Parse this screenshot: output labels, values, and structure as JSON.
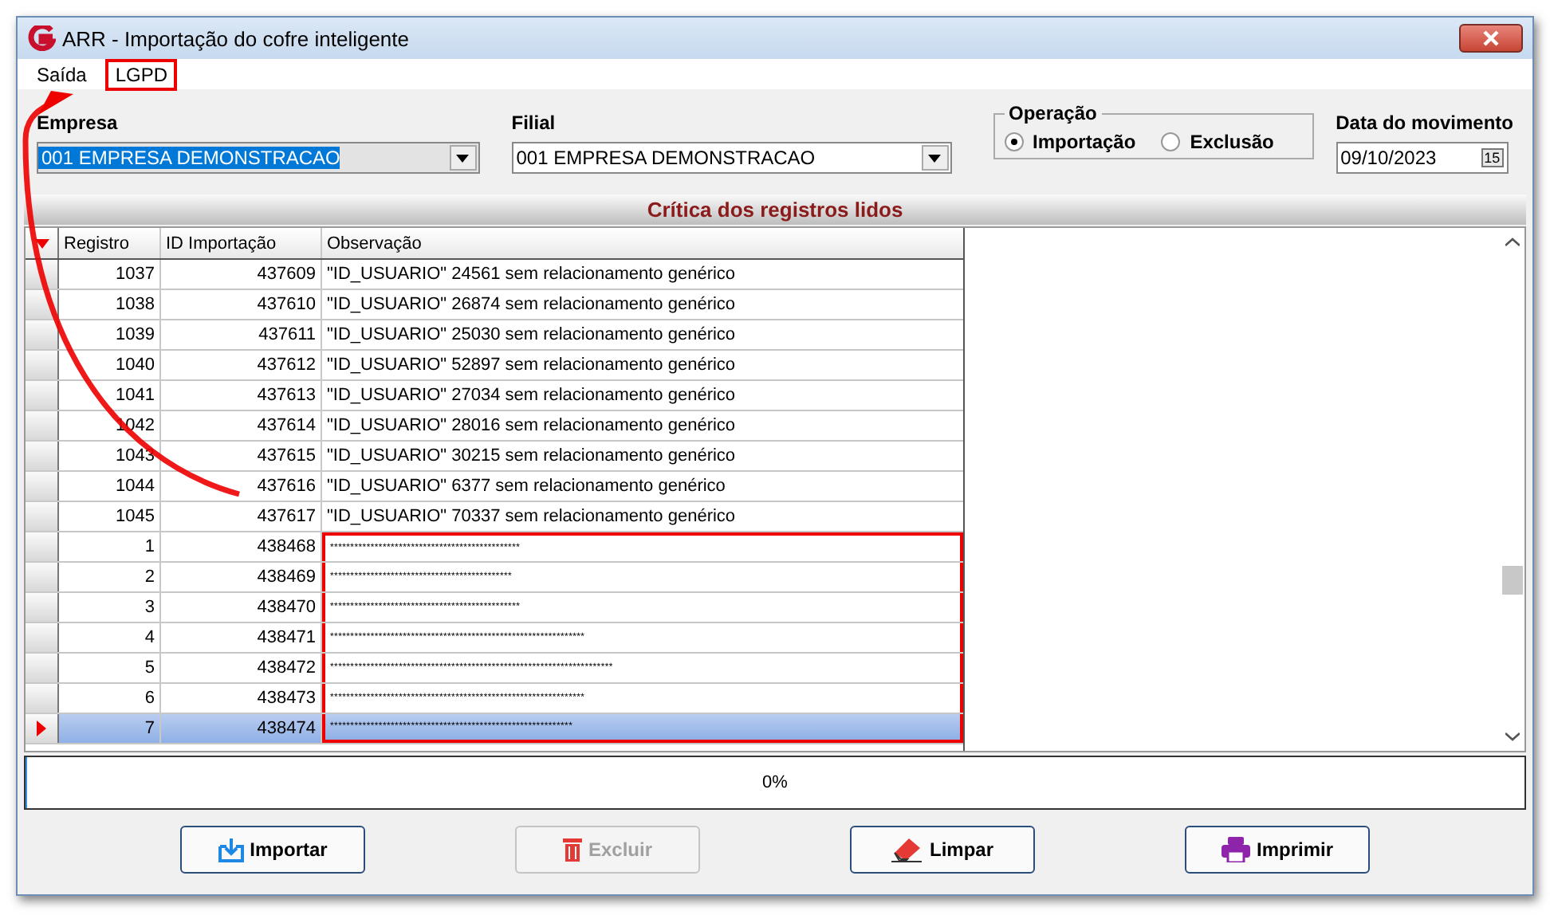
{
  "window": {
    "title": "ARR - Importação do cofre inteligente"
  },
  "menu": [
    {
      "label": "Saída",
      "highlighted": false
    },
    {
      "label": "LGPD",
      "highlighted": true
    }
  ],
  "empresa": {
    "label": "Empresa",
    "value": "001 EMPRESA DEMONSTRACAO"
  },
  "filial": {
    "label": "Filial",
    "value": "001 EMPRESA DEMONSTRACAO"
  },
  "operacao": {
    "label": "Operação",
    "options": [
      {
        "label": "Importação",
        "selected": true
      },
      {
        "label": "Exclusão",
        "selected": false
      }
    ]
  },
  "data_movimento": {
    "label": "Data do movimento",
    "value": "09/10/2023",
    "calendar_icon": "15"
  },
  "grid": {
    "title": "Crítica dos registros lidos",
    "columns": [
      "Registro",
      "ID Importação",
      "Observação"
    ],
    "rows": [
      {
        "registro": "1037",
        "id": "437609",
        "observacao": "\"ID_USUARIO\" 24561 sem relacionamento genérico",
        "selected": false,
        "highlighted": false
      },
      {
        "registro": "1038",
        "id": "437610",
        "observacao": "\"ID_USUARIO\" 26874 sem relacionamento genérico",
        "selected": false,
        "highlighted": false
      },
      {
        "registro": "1039",
        "id": "437611",
        "observacao": "\"ID_USUARIO\" 25030 sem relacionamento genérico",
        "selected": false,
        "highlighted": false
      },
      {
        "registro": "1040",
        "id": "437612",
        "observacao": "\"ID_USUARIO\" 52897 sem relacionamento genérico",
        "selected": false,
        "highlighted": false
      },
      {
        "registro": "1041",
        "id": "437613",
        "observacao": "\"ID_USUARIO\" 27034 sem relacionamento genérico",
        "selected": false,
        "highlighted": false
      },
      {
        "registro": "1042",
        "id": "437614",
        "observacao": "\"ID_USUARIO\" 28016 sem relacionamento genérico",
        "selected": false,
        "highlighted": false
      },
      {
        "registro": "1043",
        "id": "437615",
        "observacao": "\"ID_USUARIO\" 30215 sem relacionamento genérico",
        "selected": false,
        "highlighted": false
      },
      {
        "registro": "1044",
        "id": "437616",
        "observacao": "\"ID_USUARIO\" 6377 sem relacionamento genérico",
        "selected": false,
        "highlighted": false
      },
      {
        "registro": "1045",
        "id": "437617",
        "observacao": "\"ID_USUARIO\" 70337 sem relacionamento genérico",
        "selected": false,
        "highlighted": false
      },
      {
        "registro": "1",
        "id": "438468",
        "observacao": "***********************************************",
        "selected": false,
        "highlighted": true
      },
      {
        "registro": "2",
        "id": "438469",
        "observacao": "*********************************************",
        "selected": false,
        "highlighted": true
      },
      {
        "registro": "3",
        "id": "438470",
        "observacao": "***********************************************",
        "selected": false,
        "highlighted": true
      },
      {
        "registro": "4",
        "id": "438471",
        "observacao": "***************************************************************",
        "selected": false,
        "highlighted": true
      },
      {
        "registro": "5",
        "id": "438472",
        "observacao": "**********************************************************************",
        "selected": false,
        "highlighted": true
      },
      {
        "registro": "6",
        "id": "438473",
        "observacao": "***************************************************************",
        "selected": false,
        "highlighted": true
      },
      {
        "registro": "7",
        "id": "438474",
        "observacao": "************************************************************",
        "selected": true,
        "highlighted": true
      }
    ]
  },
  "progress": {
    "text": "0%",
    "level": 0
  },
  "buttons": [
    {
      "kind": "import",
      "label": "Importar",
      "disabled": false
    },
    {
      "kind": "delete",
      "label": "Excluir",
      "disabled": true
    },
    {
      "kind": "clear",
      "label": "Limpar",
      "disabled": false
    },
    {
      "kind": "print",
      "label": "Imprimir",
      "disabled": false
    }
  ]
}
